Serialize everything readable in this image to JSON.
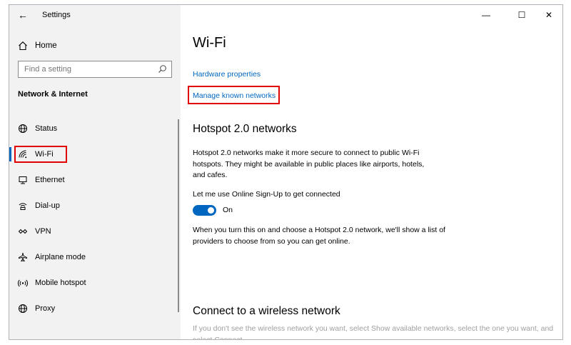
{
  "window": {
    "title": "Settings",
    "controls": {
      "minimize": "—",
      "maximize": "☐",
      "close": "✕"
    }
  },
  "sidebar": {
    "back_glyph": "←",
    "home_label": "Home",
    "search": {
      "placeholder": "Find a setting"
    },
    "section_title": "Network & Internet",
    "items": [
      {
        "label": "Status",
        "icon": "status-globe-icon"
      },
      {
        "label": "Wi-Fi",
        "icon": "wifi-icon",
        "active": true
      },
      {
        "label": "Ethernet",
        "icon": "ethernet-icon"
      },
      {
        "label": "Dial-up",
        "icon": "dialup-icon"
      },
      {
        "label": "VPN",
        "icon": "vpn-icon"
      },
      {
        "label": "Airplane mode",
        "icon": "airplane-icon"
      },
      {
        "label": "Mobile hotspot",
        "icon": "hotspot-icon"
      },
      {
        "label": "Proxy",
        "icon": "proxy-globe-icon"
      }
    ]
  },
  "main": {
    "title": "Wi-Fi",
    "links": {
      "hardware": "Hardware properties",
      "manage": "Manage known networks"
    },
    "hotspot": {
      "heading": "Hotspot 2.0 networks",
      "description": "Hotspot 2.0 networks make it more secure to connect to public Wi-Fi hotspots. They might be available in public places like airports, hotels, and cafes.",
      "signup_label": "Let me use Online Sign-Up to get connected",
      "toggle_state": "On",
      "toggle_on": true,
      "info": "When you turn this on and choose a Hotspot 2.0 network, we'll show a list of providers to choose from so you can get online."
    },
    "connect": {
      "heading": "Connect to a wireless network",
      "description": "If you don't see the wireless network you want, select Show available networks, select the one you want, and select Connect."
    }
  },
  "colors": {
    "accent": "#0067c0",
    "highlight_box": "#e00000"
  }
}
